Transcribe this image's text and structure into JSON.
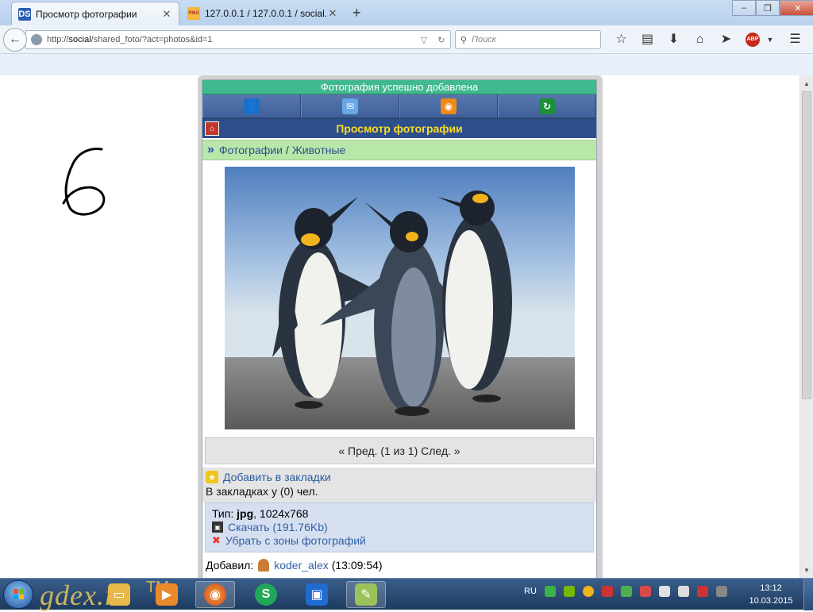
{
  "browser": {
    "tabs": [
      {
        "favicon": "DS",
        "title": "Просмотр фотографии",
        "active": true
      },
      {
        "favicon": "PMA",
        "title": "127.0.0.1 / 127.0.0.1 / social...",
        "active": false
      }
    ],
    "new_tab": "+",
    "url_host": "http://",
    "url_domain": "social",
    "url_path": "/shared_foto/?act=photos&id=1",
    "search_placeholder": "Поиск",
    "abp_label": "ABP"
  },
  "page": {
    "notice": "Фотография успешно добавлена",
    "title": "Просмотр фотографии",
    "breadcrumb": {
      "item1": "Фотографии",
      "separator": "/",
      "item2": "Животные"
    },
    "pager": "« Пред. (1 из 1) След. »",
    "bookmark_link": "Добавить в закладки",
    "bookmark_count": "В закладках у (0) чел.",
    "file_type_label": "Тип:",
    "file_type": "jpg",
    "file_size": ", 1024x768",
    "download_link": "Скачать (191.76Kb)",
    "remove_link": "Убрать с зоны фотографий",
    "added_by_label": "Добавил:",
    "added_by_user": "koder_alex",
    "added_time": "(13:09:54)"
  },
  "annotation": {
    "handwritten_digit": "6"
  },
  "taskbar": {
    "watermark": "gdex.ru",
    "tm": "TM",
    "language": "RU",
    "time": "13:12",
    "date": "10.03.2015"
  }
}
